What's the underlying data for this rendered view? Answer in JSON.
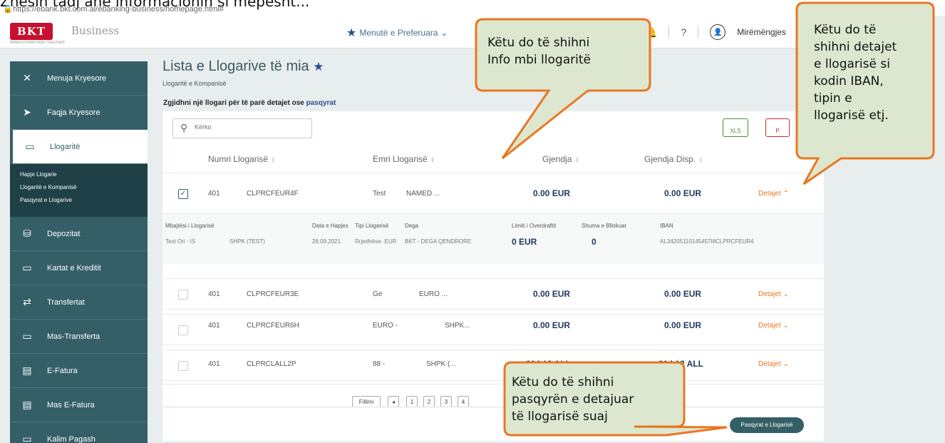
{
  "top": {
    "title_fragment": "Zhesin tadj ane informacionin si mepesht...",
    "url": "https://ebank.bkt.com.al/ebanking-business/homepage.html#"
  },
  "header": {
    "logo": "BKT",
    "logo_sub": "BANKA KOMBETARE TREGTARE",
    "business": "Business",
    "favorites": "Menutë e Preferuara",
    "help": "?",
    "greeting": "Mirëmëngjes"
  },
  "sidebar": {
    "items": [
      {
        "label": "Menuja Kryesore"
      },
      {
        "label": "Faqja Kryesore"
      },
      {
        "label": "Llogaritë"
      },
      {
        "label": "Depozitat"
      },
      {
        "label": "Kartat e Kreditit"
      },
      {
        "label": "Transfertat"
      },
      {
        "label": "Mas-Transferta"
      },
      {
        "label": "E-Fatura"
      },
      {
        "label": "Mas E-Fatura"
      },
      {
        "label": "Kalim Pagash"
      }
    ],
    "sub": [
      "Hapje Llogarie",
      "Llogaritë e Kompanisë",
      "Pasqyrat e Llogarive"
    ]
  },
  "main": {
    "title": "Lista e Llogarive të mia",
    "subtitle": "Llogaritë e Kompanisë",
    "hint": "Zgjidhni një llogari për të parë detajet ose",
    "hint_link": "pasqyrat",
    "search_placeholder": "Kërko",
    "xls": "XLS",
    "pdf": "P"
  },
  "table": {
    "headers": [
      "Numri Llogarisë",
      "Emri Llogarisë",
      "Gjendja",
      "Gjendja Disp."
    ],
    "rows": [
      {
        "checked": "✓",
        "code": "401",
        "acc": "CLPRCFEUR4F",
        "name1": "Test",
        "name2": "NAMED ...",
        "bal": "0.00 EUR",
        "disp": "0.00 EUR",
        "det": "Detajet ⌃"
      },
      {
        "checked": "",
        "code": "401",
        "acc": "CLPRCFEUR3E",
        "name1": "Ge",
        "name2": "EURO ...",
        "bal": "0.00 EUR",
        "disp": "0.00 EUR",
        "det": "Detajet ⌄"
      },
      {
        "checked": "",
        "code": "401",
        "acc": "CLPRCFEUR6H",
        "name1": "EURO -",
        "name2": "SHPK...",
        "bal": "0.00 EUR",
        "disp": "0.00 EUR",
        "det": "Detajet ⌄"
      },
      {
        "checked": "",
        "code": "401",
        "acc": "CLPRCLALL2P",
        "name1": "88 -",
        "name2": "SHPK (...",
        "bal": "204.12 ALL",
        "disp": "204.12 ALL",
        "det": "Detajet ⌄"
      }
    ],
    "details": {
      "labels": [
        "Mbajtësi i Llogarisë",
        "Data e Hapjes",
        "Tipi Llogarisë",
        "Dega",
        "Limiti i Overdraftit",
        "Shuma e Bllokuar",
        "IBAN"
      ],
      "holder1": "Test Ori - IS",
      "holder2": "SHPK (TEST)",
      "date": "28.09.2021",
      "type": "Rrjedhëse- EUR",
      "branch": "BKT - DEGA QENDRORE",
      "overdraft": "0 EUR",
      "blocked": "0",
      "iban": "AL34205110145457I8CLPRCFEUR4"
    },
    "pager": {
      "first": "Fillimi",
      "prev": "◂",
      "pages": [
        "1",
        "2",
        "3",
        "4"
      ]
    }
  },
  "bottom": {
    "button": "Pasqyrat e Llogarisë"
  },
  "callouts": {
    "info": [
      "Këtu do të shihni",
      "Info mbi llogaritë"
    ],
    "details": [
      "Këtu do të",
      "shihni detajet",
      "e llogarisë si",
      "kodin IBAN,",
      "tipin e",
      "llogarisë etj."
    ],
    "statement": [
      "Këtu do të shihni",
      "pasqyrën e detajuar",
      "të llogarisë suaj"
    ]
  }
}
